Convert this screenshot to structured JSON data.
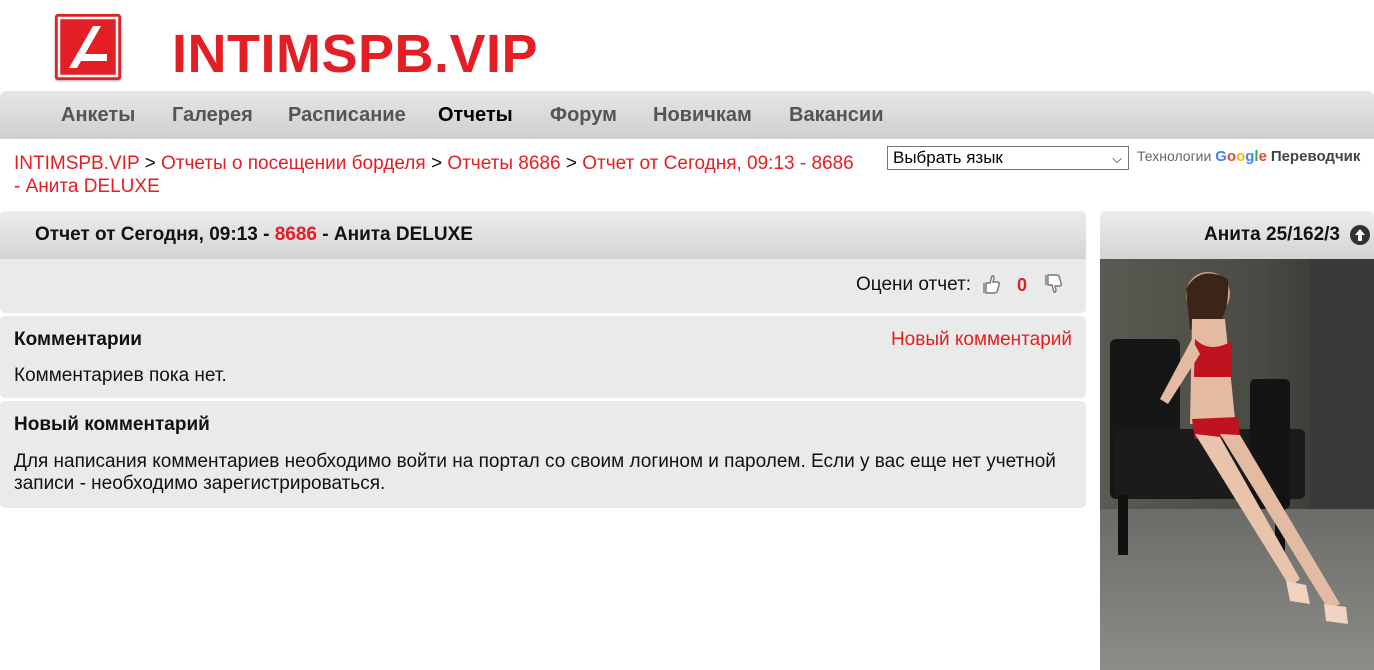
{
  "header": {
    "title": "INTIMSPB.VIP",
    "logo_icon": "logo-a-icon",
    "brand_color": "#e31e24"
  },
  "nav": {
    "items": [
      {
        "label": "Анкеты"
      },
      {
        "label": "Галерея"
      },
      {
        "label": "Расписание"
      },
      {
        "label": "Отчеты",
        "active": true
      },
      {
        "label": "Форум"
      },
      {
        "label": "Новичкам"
      },
      {
        "label": "Вакансии"
      }
    ]
  },
  "breadcrumb": {
    "items": [
      {
        "label": "INTIMSPB.VIP"
      },
      {
        "label": "Отчеты о посещении борделя"
      },
      {
        "label": "Отчеты 8686"
      },
      {
        "label": "Отчет от Сегодня, 09:13 - 8686 - Анита DELUXE"
      }
    ],
    "separator": ">"
  },
  "translate": {
    "select_value": "Выбрать язык",
    "powered_prefix": "Технологии",
    "google": "Google",
    "product": "Переводчик"
  },
  "report": {
    "title_prefix": "Отчет от Сегодня, 09:13 -",
    "title_number": "8686",
    "title_suffix": "- Анита DELUXE",
    "rate_label": "Оцени отчет:",
    "rate_count": "0"
  },
  "comments": {
    "title": "Комментарии",
    "new_link": "Новый комментарий",
    "empty_text": "Комментариев пока нет."
  },
  "new_comment": {
    "title": "Новый комментарий",
    "text": "Для написания комментариев необходимо войти на портал со своим логином и паролем. Если у вас еще нет учетной записи - необходимо зарегистрироваться."
  },
  "side": {
    "title": "Анита 25/162/3",
    "up_icon": "arrow-up-circle-icon",
    "photo_icon": "profile-photo"
  }
}
